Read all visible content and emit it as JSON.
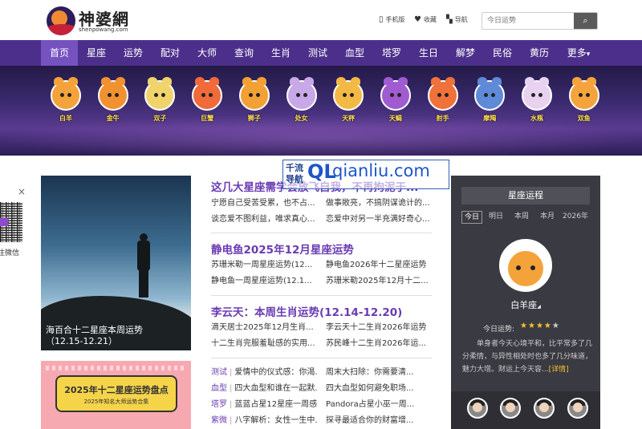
{
  "site": {
    "title": "神婆網",
    "domain": "shenpowang.com"
  },
  "top_links": [
    {
      "icon": "mobile-icon",
      "label": "手机版"
    },
    {
      "icon": "heart-icon",
      "label": "收藏"
    },
    {
      "icon": "grid-icon",
      "label": "导航"
    }
  ],
  "search": {
    "placeholder": "今日运势"
  },
  "nav": [
    "首页",
    "星座",
    "运势",
    "配对",
    "大师",
    "查询",
    "生肖",
    "测试",
    "血型",
    "塔罗",
    "生日",
    "解梦",
    "民俗",
    "黄历",
    "更多"
  ],
  "nav_more_caret": "▾",
  "zodiac": [
    {
      "name": "白羊",
      "color": "#f4a33a"
    },
    {
      "name": "金牛",
      "color": "#f2912f"
    },
    {
      "name": "双子",
      "color": "#f0d36a"
    },
    {
      "name": "巨蟹",
      "color": "#f06a3a"
    },
    {
      "name": "狮子",
      "color": "#f3a034"
    },
    {
      "name": "处女",
      "color": "#c9a8e8"
    },
    {
      "name": "天秤",
      "color": "#f2ba44"
    },
    {
      "name": "天蝎",
      "color": "#a05bd1"
    },
    {
      "name": "射手",
      "color": "#f0713a"
    },
    {
      "name": "摩羯",
      "color": "#5f8ad8"
    },
    {
      "name": "水瓶",
      "color": "#e8d2f0"
    },
    {
      "name": "双鱼",
      "color": "#f5a43d"
    }
  ],
  "feature": {
    "caption_line1": "海百合十二星座本周运势",
    "caption_line2": "（12.15-12.21）"
  },
  "promo": {
    "title": "2025年十二星座运势盘点",
    "subtitle": "2025年知名大师运势合集"
  },
  "sections": [
    {
      "headline": "这几大星座需学会放飞自我，不再拘泥于...",
      "rows": [
        [
          "宁愿自己受苦受累，也不占...",
          "做事敞亮，不搞阴谋诡计的..."
        ],
        [
          "谈恋爱不图利益，唯求真心...",
          "恋爱中对另一半充满好奇心..."
        ]
      ]
    },
    {
      "headline": "静电鱼2025年12月星座运势",
      "rows": [
        [
          "苏珊米勒一周星座运势(12...",
          "静电鱼2026年十二星座运势"
        ],
        [
          "静电鱼一周星座运势(12.1...",
          "苏珊米勒2025年12月十二..."
        ]
      ]
    },
    {
      "headline": "李云天：本周生肖运势(12.14-12.20)",
      "rows": [
        [
          "滴天居士2025年12月生肖...",
          "李云天十二生肖2026年运势"
        ],
        [
          "十二生肖完服羞耻感的实用...",
          "苏民峰十二生肖2026年运..."
        ]
      ]
    }
  ],
  "categories": [
    {
      "cat": "测试",
      "a": "爱情中的仪式感：你渴...",
      "b": "周末大扫除：你需要清..."
    },
    {
      "cat": "血型",
      "a": "四大血型和谁在一起默...",
      "b": "四大血型如何避免职场..."
    },
    {
      "cat": "塔罗",
      "a": "蓝蓝占星12星座一周感...",
      "b": "Pandora占星小巫一周..."
    },
    {
      "cat": "紫微",
      "a": "八字解析：女性一生中...",
      "b": "探寻最适合你的财富增..."
    }
  ],
  "fortune": {
    "header": "星座运程",
    "tabs": [
      "今日",
      "明日",
      "本周",
      "本月",
      "2026年"
    ],
    "active_tab": 0,
    "sign": "白羊座",
    "sign_caret": "◢",
    "luck_label": "今日运势:",
    "stars": 4,
    "max_stars": 5,
    "desc": "单身者今天心境平和，比平常多了几分柔情，与异性相处时也多了几分味道，魅力大增。财运上今天容...",
    "more": "[详情]"
  },
  "qr": {
    "close": "×",
    "label": "关注微信"
  },
  "watermark": {
    "small": "千流导航",
    "big": "QL",
    "url": "qianliu.com"
  },
  "colors": {
    "nav": "#4c2f8b",
    "nav_active": "#7552c0",
    "accent": "#6a3bb3",
    "star": "#f7c330"
  }
}
